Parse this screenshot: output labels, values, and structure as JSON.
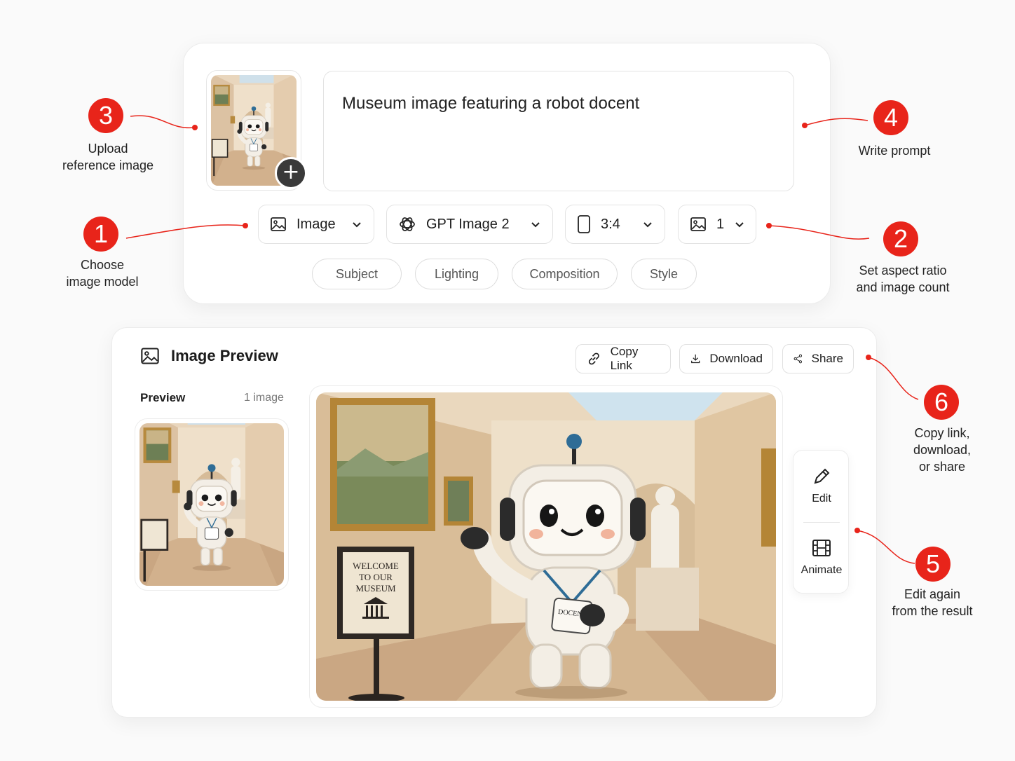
{
  "composer": {
    "prompt_text": "Museum image featuring a robot docent",
    "add_reference_symbol": "+",
    "type_dropdown": {
      "label": "Image",
      "icon": "image-icon"
    },
    "model_dropdown": {
      "label": "GPT Image 2",
      "icon": "openai-logo-icon"
    },
    "ratio_dropdown": {
      "label": "3:4",
      "icon": "portrait-frame-icon"
    },
    "count_dropdown": {
      "label": "1",
      "icon": "image-icon"
    },
    "chips": [
      "Subject",
      "Lighting",
      "Composition",
      "Style"
    ]
  },
  "preview": {
    "title": "Image Preview",
    "sidebar_label": "Preview",
    "sidebar_count": "1 image",
    "actions": {
      "copy_link": "Copy Link",
      "download": "Download",
      "share": "Share"
    },
    "tools": {
      "edit": "Edit",
      "animate": "Animate"
    },
    "sign": {
      "line1": "WELCOME",
      "line2": "TO OUR",
      "line3": "MUSEUM"
    },
    "badge": "DOCENT"
  },
  "annotations": [
    {
      "num": "1",
      "text": "Choose\nimage model"
    },
    {
      "num": "2",
      "text": "Set aspect ratio\nand image count"
    },
    {
      "num": "3",
      "text": "Upload\nreference image"
    },
    {
      "num": "4",
      "text": "Write prompt"
    },
    {
      "num": "5",
      "text": "Edit again\nfrom the result"
    },
    {
      "num": "6",
      "text": "Copy link,\ndownload,\nor share"
    }
  ],
  "colors": {
    "accent": "#e8241a",
    "background": "#fafafa",
    "card": "#ffffff"
  }
}
